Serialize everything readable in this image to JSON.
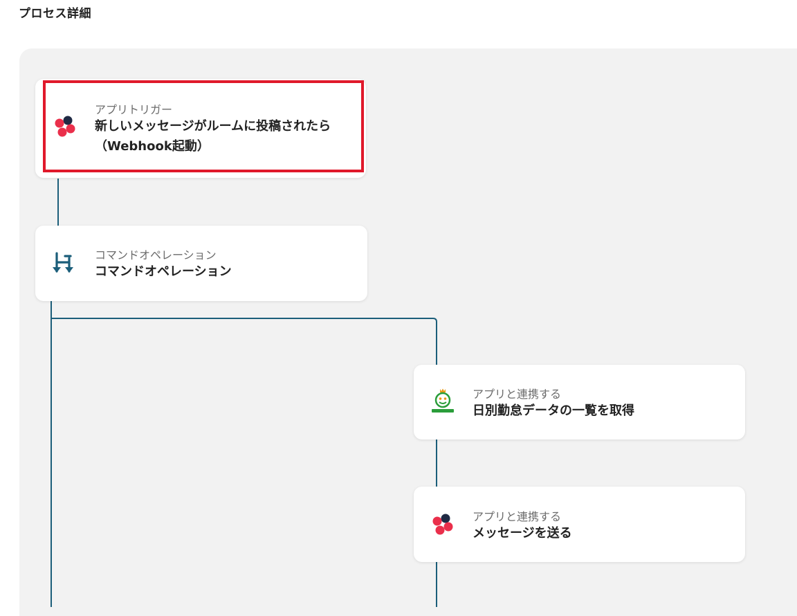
{
  "header": {
    "title": "プロセス詳細"
  },
  "flow": {
    "trigger": {
      "type_label": "アプリトリガー",
      "title_line1": "新しいメッセージがルームに投稿されたら",
      "title_line2": "（Webhook起動）",
      "icon": "chatwork-logo-icon"
    },
    "command": {
      "type_label": "コマンドオペレーション",
      "title": "コマンドオペレーション",
      "icon": "branch-arrow-icon"
    },
    "step_kot": {
      "type_label": "アプリと連携する",
      "title": "日別勤怠データの一覧を取得",
      "icon": "king-of-time-logo-icon"
    },
    "step_send": {
      "type_label": "アプリと連携する",
      "title": "メッセージを送る",
      "icon": "chatwork-logo-icon"
    }
  },
  "colors": {
    "connector": "#1b5e7a",
    "highlight": "#e0192b",
    "canvas": "#f2f2f2",
    "chatwork_red": "#ea2f4b",
    "chatwork_dark": "#1f2a44",
    "kot_green": "#2a9d3a",
    "kot_orange": "#e89a17"
  }
}
